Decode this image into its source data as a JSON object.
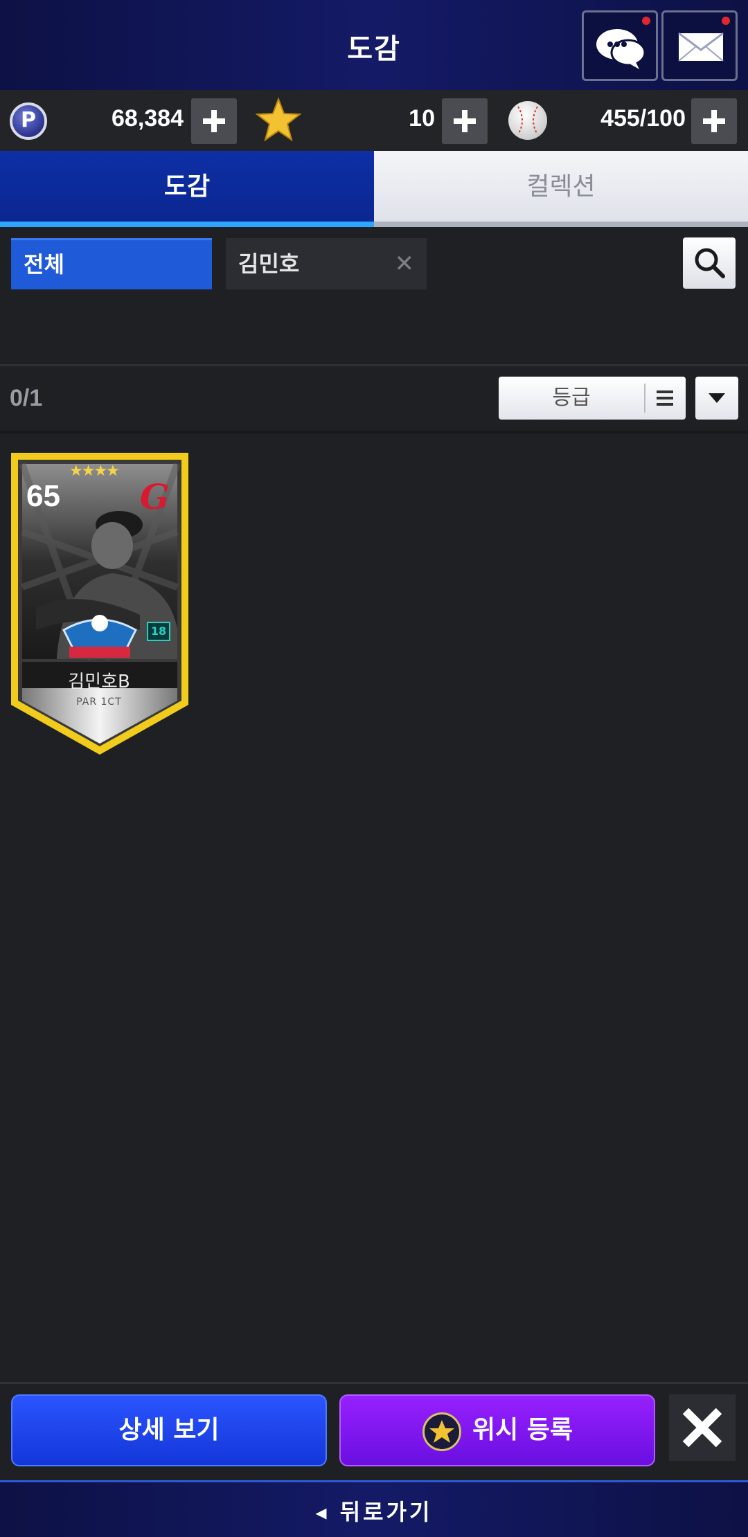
{
  "header": {
    "title": "도감"
  },
  "currency": {
    "p_icon_letter": "P",
    "points": "68,384",
    "stars": "10",
    "balls": "455/100"
  },
  "tabs": [
    {
      "label": "도감",
      "active": true
    },
    {
      "label": "컬렉션",
      "active": false
    }
  ],
  "filter": {
    "all_label": "전체",
    "search_chip": "김민호",
    "chip_close": "✕"
  },
  "list": {
    "count": "0/1",
    "sort_label": "등급"
  },
  "card": {
    "rating": "65",
    "stars": "★★★★",
    "team_logo": "G",
    "badge": "18",
    "name": "김민호B",
    "position": "PAR 1CT"
  },
  "actions": {
    "detail_label": "상세 보기",
    "wish_label": "위시 등록",
    "close_icon": "close-icon"
  },
  "footer": {
    "back_label": "◂ 뒤로가기"
  },
  "colors": {
    "header_bg": "#141a66",
    "tab_active": "#0e2fa6",
    "detail_button": "#1f45f0",
    "wish_button": "#8418f4",
    "card_border": "#f2cc1d"
  }
}
